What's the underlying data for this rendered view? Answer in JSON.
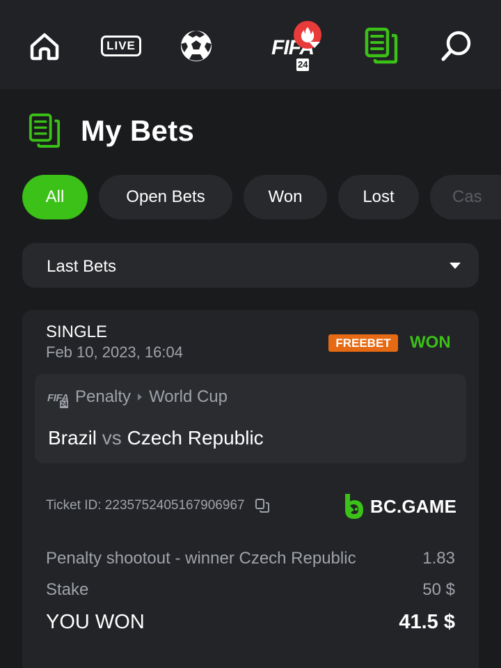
{
  "nav": {
    "live_label": "LIVE",
    "fifa_label": "FIFA",
    "fifa_year": "24",
    "icons": [
      "home-icon",
      "live-icon",
      "soccer-ball-icon",
      "fifa-icon",
      "fire-icon",
      "bets-icon",
      "search-icon"
    ]
  },
  "page": {
    "title": "My Bets"
  },
  "filters": [
    {
      "label": "All",
      "active": true
    },
    {
      "label": "Open Bets",
      "active": false
    },
    {
      "label": "Won",
      "active": false
    },
    {
      "label": "Lost",
      "active": false
    },
    {
      "label": "Cas",
      "active": false
    }
  ],
  "dropdown": {
    "selected": "Last Bets"
  },
  "bet": {
    "type": "SINGLE",
    "date": "Feb 10, 2023, 16:04",
    "badge": "FREEBET",
    "status": "WON",
    "event": {
      "sport": "Penalty",
      "league": "World Cup",
      "team_home": "Brazil",
      "vs": "vs",
      "team_away": "Czech Republic"
    },
    "ticket_id": "Ticket ID: 2235752405167906967",
    "brand": "BC.GAME",
    "pick": {
      "label": "Penalty shootout - winner Czech Republic",
      "odds": "1.83"
    },
    "stake": {
      "label": "Stake",
      "value": "50 $"
    },
    "result": {
      "label": "YOU WON",
      "value": "41.5 $"
    }
  },
  "colors": {
    "accent": "#3bc117",
    "background": "#1a1b1d",
    "surface": "#28292d",
    "freebet": "#e66a13",
    "fire": "#ea3b3b",
    "muted_text": "#9fa3aa"
  }
}
